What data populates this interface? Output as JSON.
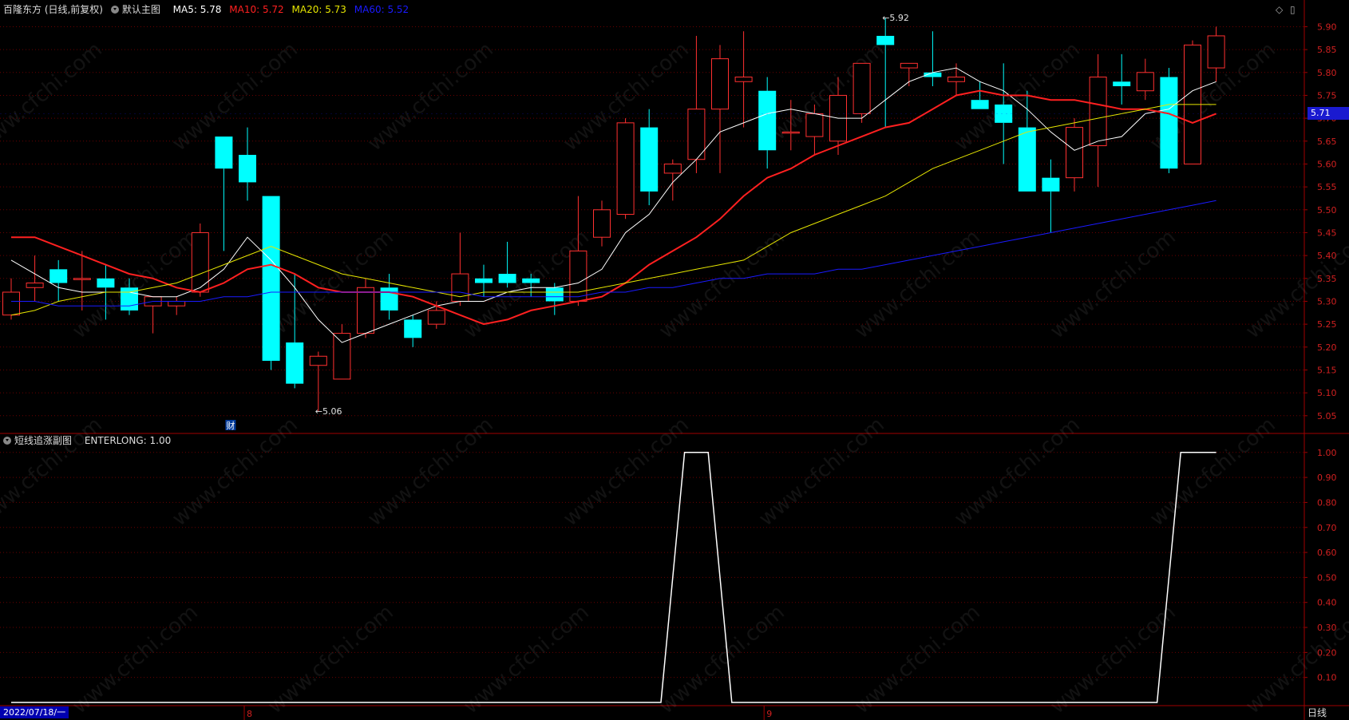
{
  "header": {
    "stock": "百隆东方 (日线,前复权)",
    "template": "默认主图",
    "ma": [
      {
        "label": "MA5: 5.78",
        "color": "#ffffff"
      },
      {
        "label": "MA10: 5.72",
        "color": "#ff2020"
      },
      {
        "label": "MA20: 5.73",
        "color": "#e6e600"
      },
      {
        "label": "MA60: 5.52",
        "color": "#1a1aff"
      }
    ]
  },
  "sub_header": {
    "name": "短线追涨副图",
    "value": "ENTERLONG: 1.00"
  },
  "current_price": "5.71",
  "date_label": "2022/07/18/一",
  "period_label": "日线",
  "month_marks": [
    "8",
    "9"
  ],
  "cai_marker": "财",
  "watermark": "www.cfchi.com",
  "chart_data": [
    {
      "type": "candlestick",
      "title": "",
      "ylim": [
        5.02,
        5.92
      ],
      "y_ticks": [
        5.05,
        5.1,
        5.15,
        5.2,
        5.25,
        5.3,
        5.35,
        5.4,
        5.45,
        5.5,
        5.55,
        5.6,
        5.65,
        5.7,
        5.75,
        5.8,
        5.85,
        5.9
      ],
      "up_color": "#ff3030",
      "down_color": "#00ffff",
      "candles": [
        {
          "o": 5.27,
          "h": 5.35,
          "l": 5.26,
          "c": 5.32
        },
        {
          "o": 5.33,
          "h": 5.4,
          "l": 5.3,
          "c": 5.34
        },
        {
          "o": 5.37,
          "h": 5.39,
          "l": 5.3,
          "c": 5.34
        },
        {
          "o": 5.35,
          "h": 5.41,
          "l": 5.28,
          "c": 5.35
        },
        {
          "o": 5.35,
          "h": 5.38,
          "l": 5.26,
          "c": 5.33
        },
        {
          "o": 5.33,
          "h": 5.35,
          "l": 5.27,
          "c": 5.28
        },
        {
          "o": 5.29,
          "h": 5.31,
          "l": 5.23,
          "c": 5.31
        },
        {
          "o": 5.29,
          "h": 5.31,
          "l": 5.27,
          "c": 5.3
        },
        {
          "o": 5.32,
          "h": 5.47,
          "l": 5.31,
          "c": 5.45
        },
        {
          "o": 5.66,
          "h": 5.66,
          "l": 5.41,
          "c": 5.59
        },
        {
          "o": 5.62,
          "h": 5.68,
          "l": 5.52,
          "c": 5.56
        },
        {
          "o": 5.53,
          "h": 5.53,
          "l": 5.15,
          "c": 5.17
        },
        {
          "o": 5.21,
          "h": 5.36,
          "l": 5.11,
          "c": 5.12
        },
        {
          "o": 5.16,
          "h": 5.19,
          "l": 5.06,
          "c": 5.18
        },
        {
          "o": 5.13,
          "h": 5.25,
          "l": 5.13,
          "c": 5.23
        },
        {
          "o": 5.23,
          "h": 5.35,
          "l": 5.22,
          "c": 5.33
        },
        {
          "o": 5.33,
          "h": 5.36,
          "l": 5.26,
          "c": 5.28
        },
        {
          "o": 5.26,
          "h": 5.27,
          "l": 5.2,
          "c": 5.22
        },
        {
          "o": 5.25,
          "h": 5.3,
          "l": 5.24,
          "c": 5.28
        },
        {
          "o": 5.3,
          "h": 5.45,
          "l": 5.29,
          "c": 5.36
        },
        {
          "o": 5.35,
          "h": 5.38,
          "l": 5.31,
          "c": 5.34
        },
        {
          "o": 5.36,
          "h": 5.43,
          "l": 5.33,
          "c": 5.34
        },
        {
          "o": 5.35,
          "h": 5.36,
          "l": 5.31,
          "c": 5.34
        },
        {
          "o": 5.33,
          "h": 5.34,
          "l": 5.27,
          "c": 5.3
        },
        {
          "o": 5.3,
          "h": 5.53,
          "l": 5.29,
          "c": 5.41
        },
        {
          "o": 5.44,
          "h": 5.52,
          "l": 5.42,
          "c": 5.5
        },
        {
          "o": 5.49,
          "h": 5.7,
          "l": 5.48,
          "c": 5.69
        },
        {
          "o": 5.68,
          "h": 5.72,
          "l": 5.51,
          "c": 5.54
        },
        {
          "o": 5.58,
          "h": 5.61,
          "l": 5.52,
          "c": 5.6
        },
        {
          "o": 5.61,
          "h": 5.88,
          "l": 5.58,
          "c": 5.72
        },
        {
          "o": 5.72,
          "h": 5.86,
          "l": 5.58,
          "c": 5.83
        },
        {
          "o": 5.78,
          "h": 5.89,
          "l": 5.68,
          "c": 5.79
        },
        {
          "o": 5.76,
          "h": 5.79,
          "l": 5.59,
          "c": 5.63
        },
        {
          "o": 5.67,
          "h": 5.74,
          "l": 5.63,
          "c": 5.67
        },
        {
          "o": 5.66,
          "h": 5.73,
          "l": 5.62,
          "c": 5.71
        },
        {
          "o": 5.65,
          "h": 5.79,
          "l": 5.62,
          "c": 5.75
        },
        {
          "o": 5.71,
          "h": 5.82,
          "l": 5.69,
          "c": 5.82
        },
        {
          "o": 5.88,
          "h": 5.92,
          "l": 5.68,
          "c": 5.86
        },
        {
          "o": 5.81,
          "h": 5.82,
          "l": 5.77,
          "c": 5.82
        },
        {
          "o": 5.8,
          "h": 5.89,
          "l": 5.77,
          "c": 5.79
        },
        {
          "o": 5.78,
          "h": 5.82,
          "l": 5.75,
          "c": 5.79
        },
        {
          "o": 5.74,
          "h": 5.78,
          "l": 5.72,
          "c": 5.72
        },
        {
          "o": 5.73,
          "h": 5.82,
          "l": 5.6,
          "c": 5.69
        },
        {
          "o": 5.68,
          "h": 5.76,
          "l": 5.54,
          "c": 5.54
        },
        {
          "o": 5.57,
          "h": 5.61,
          "l": 5.45,
          "c": 5.54
        },
        {
          "o": 5.57,
          "h": 5.7,
          "l": 5.54,
          "c": 5.68
        },
        {
          "o": 5.64,
          "h": 5.84,
          "l": 5.55,
          "c": 5.79
        },
        {
          "o": 5.78,
          "h": 5.84,
          "l": 5.73,
          "c": 5.77
        },
        {
          "o": 5.76,
          "h": 5.83,
          "l": 5.74,
          "c": 5.8
        },
        {
          "o": 5.79,
          "h": 5.81,
          "l": 5.58,
          "c": 5.59
        },
        {
          "o": 5.6,
          "h": 5.87,
          "l": 5.6,
          "c": 5.86
        },
        {
          "o": 5.81,
          "h": 5.9,
          "l": 5.78,
          "c": 5.88
        }
      ],
      "series": [
        {
          "name": "MA5",
          "color": "#ffffff",
          "width": 1,
          "values": [
            5.39,
            5.36,
            5.33,
            5.32,
            5.32,
            5.32,
            5.31,
            5.31,
            5.33,
            5.37,
            5.44,
            5.39,
            5.33,
            5.26,
            5.21,
            5.23,
            5.25,
            5.27,
            5.29,
            5.3,
            5.3,
            5.32,
            5.33,
            5.33,
            5.34,
            5.37,
            5.45,
            5.49,
            5.56,
            5.61,
            5.67,
            5.69,
            5.71,
            5.72,
            5.71,
            5.7,
            5.7,
            5.74,
            5.78,
            5.8,
            5.81,
            5.78,
            5.76,
            5.72,
            5.67,
            5.63,
            5.65,
            5.66,
            5.71,
            5.72,
            5.76,
            5.78
          ]
        },
        {
          "name": "MA10",
          "color": "#ff2020",
          "width": 2,
          "values": [
            5.44,
            5.44,
            5.42,
            5.4,
            5.38,
            5.36,
            5.35,
            5.33,
            5.32,
            5.34,
            5.37,
            5.38,
            5.36,
            5.33,
            5.32,
            5.32,
            5.32,
            5.31,
            5.29,
            5.27,
            5.25,
            5.26,
            5.28,
            5.29,
            5.3,
            5.31,
            5.34,
            5.38,
            5.41,
            5.44,
            5.48,
            5.53,
            5.57,
            5.59,
            5.62,
            5.64,
            5.66,
            5.68,
            5.69,
            5.72,
            5.75,
            5.76,
            5.75,
            5.75,
            5.74,
            5.74,
            5.73,
            5.72,
            5.72,
            5.71,
            5.69,
            5.71
          ]
        },
        {
          "name": "MA20",
          "color": "#e6e600",
          "width": 1,
          "values": [
            5.27,
            5.28,
            5.3,
            5.31,
            5.32,
            5.32,
            5.33,
            5.34,
            5.36,
            5.38,
            5.4,
            5.42,
            5.4,
            5.38,
            5.36,
            5.35,
            5.34,
            5.33,
            5.32,
            5.31,
            5.32,
            5.32,
            5.32,
            5.32,
            5.32,
            5.33,
            5.34,
            5.35,
            5.36,
            5.37,
            5.38,
            5.39,
            5.42,
            5.45,
            5.47,
            5.49,
            5.51,
            5.53,
            5.56,
            5.59,
            5.61,
            5.63,
            5.65,
            5.67,
            5.68,
            5.69,
            5.7,
            5.71,
            5.72,
            5.73,
            5.73,
            5.73
          ]
        },
        {
          "name": "MA60",
          "color": "#1a1aff",
          "width": 1,
          "values": [
            5.3,
            5.3,
            5.29,
            5.29,
            5.29,
            5.29,
            5.3,
            5.3,
            5.3,
            5.31,
            5.31,
            5.32,
            5.32,
            5.32,
            5.32,
            5.32,
            5.32,
            5.32,
            5.32,
            5.32,
            5.31,
            5.31,
            5.31,
            5.31,
            5.31,
            5.32,
            5.32,
            5.33,
            5.33,
            5.34,
            5.35,
            5.35,
            5.36,
            5.36,
            5.36,
            5.37,
            5.37,
            5.38,
            5.39,
            5.4,
            5.41,
            5.42,
            5.43,
            5.44,
            5.45,
            5.46,
            5.47,
            5.48,
            5.49,
            5.5,
            5.51,
            5.52
          ]
        }
      ],
      "annotations": [
        {
          "label": "5.92",
          "candle": 37,
          "price": 5.92
        },
        {
          "label": "5.06",
          "candle": 13,
          "price": 5.06
        }
      ]
    },
    {
      "type": "line",
      "title": "",
      "ylim": [
        0,
        1.06
      ],
      "y_ticks": [
        0.1,
        0.2,
        0.3,
        0.4,
        0.5,
        0.6,
        0.7,
        0.8,
        0.9,
        1.0
      ],
      "series": [
        {
          "name": "ENTERLONG",
          "color": "#ffffff",
          "points": [
            [
              0,
              0
            ],
            [
              27.5,
              0
            ],
            [
              28.5,
              1
            ],
            [
              29.5,
              1
            ],
            [
              30.5,
              0
            ],
            [
              48.5,
              0
            ],
            [
              49.5,
              1
            ],
            [
              51,
              1
            ]
          ]
        }
      ]
    }
  ]
}
